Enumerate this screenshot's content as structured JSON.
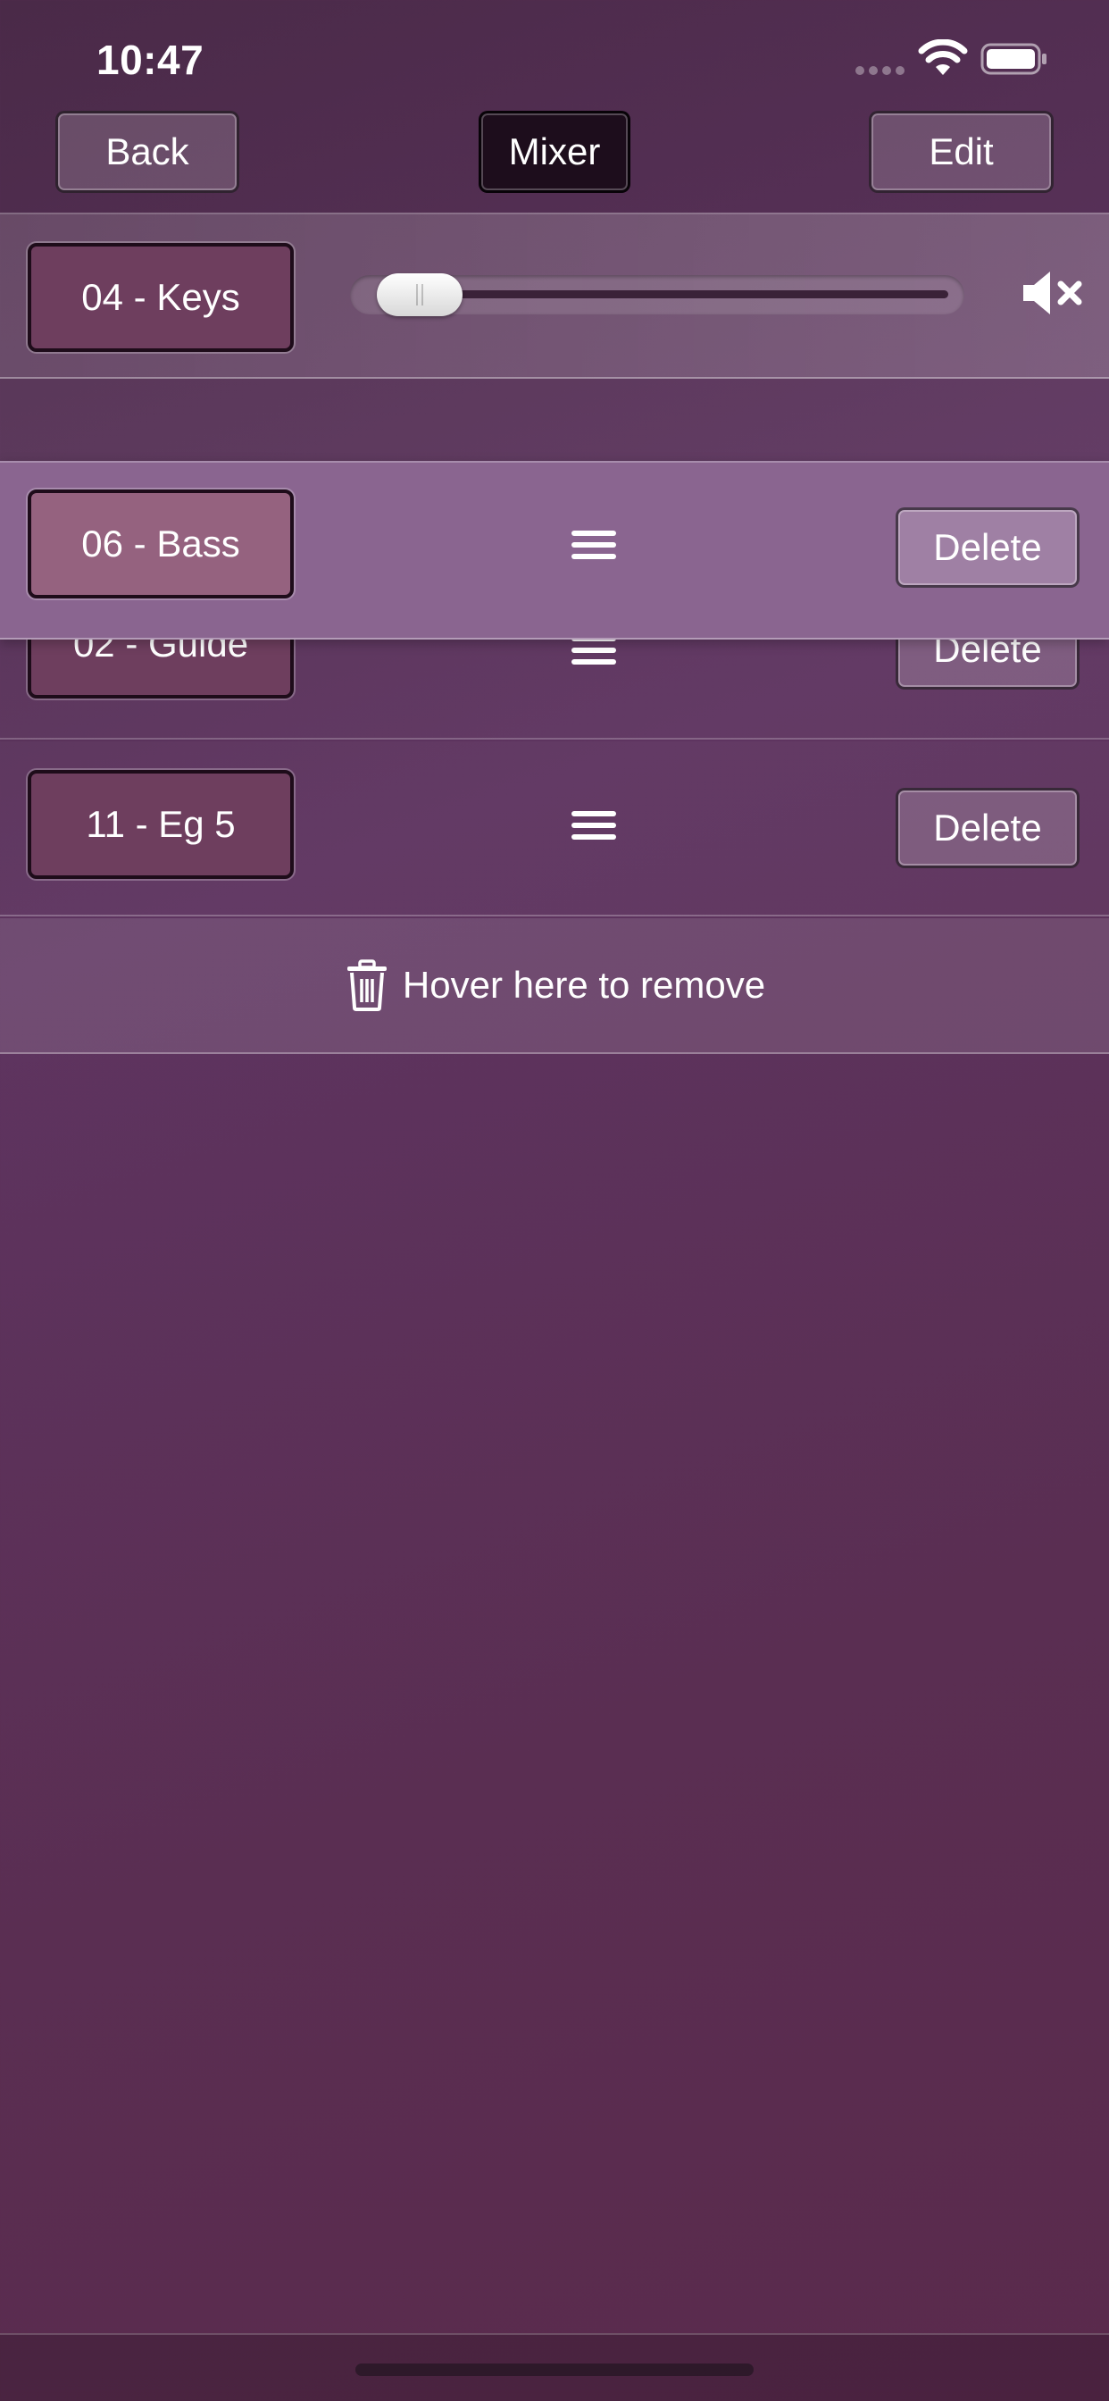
{
  "status_bar": {
    "time": "10:47"
  },
  "nav": {
    "back_label": "Back",
    "title_label": "Mixer",
    "edit_label": "Edit"
  },
  "volume_track": {
    "name": "04 - Keys",
    "volume_level": 0.05,
    "muted": true
  },
  "tracks": [
    {
      "name": "06 - Bass",
      "delete_label": "Delete",
      "state": "dragging"
    },
    {
      "name": "02 - Guide",
      "delete_label": "Delete"
    },
    {
      "name": "11 - Eg 5",
      "delete_label": "Delete"
    }
  ],
  "remove_zone": {
    "label": "Hover here to remove"
  },
  "icons": {
    "signal": "cellular-signal-icon",
    "wifi": "wifi-icon",
    "battery": "battery-icon",
    "mute": "speaker-muted-icon",
    "drag": "drag-handle-icon",
    "trash": "trash-icon"
  },
  "colors": {
    "background": "#5e3460",
    "dragged_row": "#8a6590",
    "track_button": "#6e3e5e",
    "mixer_button": "#1d0d1c"
  }
}
